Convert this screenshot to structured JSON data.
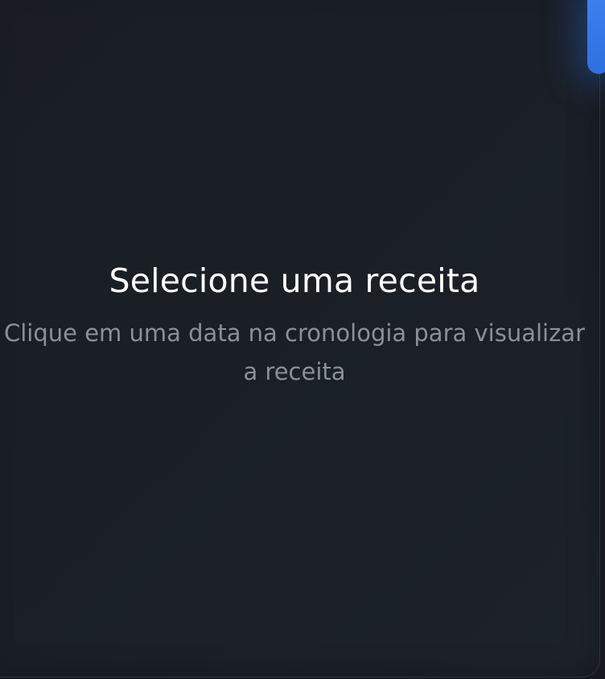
{
  "empty_state": {
    "title": "Selecione uma receita",
    "subtitle": "Clique em uma data na cronologia para visualizar a receita"
  },
  "colors": {
    "background": "#1a1f26",
    "title": "#ffffff",
    "subtitle": "#8a9099",
    "accent": "#3f82f2"
  }
}
